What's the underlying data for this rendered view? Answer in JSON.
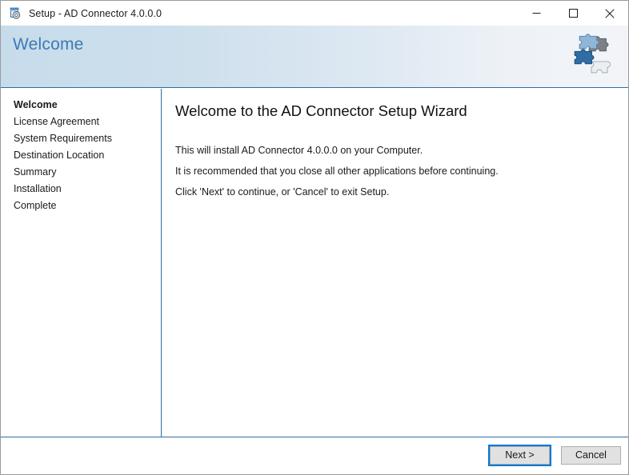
{
  "window": {
    "title": "Setup - AD Connector 4.0.0.0",
    "app_icon": "installer-box-icon",
    "controls": {
      "minimize": "minimize-icon",
      "maximize": "maximize-icon",
      "close": "close-icon"
    }
  },
  "header": {
    "title": "Welcome",
    "icon": "puzzle-pieces-icon",
    "accent_color": "#3d7ab5",
    "border_color": "#2e6da4",
    "gradient_from": "#c7dceb",
    "gradient_to": "#f2f4f8"
  },
  "sidebar": {
    "items": [
      {
        "label": "Welcome",
        "current": true
      },
      {
        "label": "License Agreement",
        "current": false
      },
      {
        "label": "System Requirements",
        "current": false
      },
      {
        "label": "Destination Location",
        "current": false
      },
      {
        "label": "Summary",
        "current": false
      },
      {
        "label": "Installation",
        "current": false
      },
      {
        "label": "Complete",
        "current": false
      }
    ]
  },
  "content": {
    "heading": "Welcome to the AD Connector Setup Wizard",
    "paragraphs": [
      "This will install AD Connector 4.0.0.0 on your Computer.",
      "It is recommended that you close all other applications before continuing.",
      "Click 'Next' to continue, or 'Cancel' to exit Setup."
    ]
  },
  "footer": {
    "next_label": "Next >",
    "cancel_label": "Cancel",
    "focus_color": "#0078d7"
  }
}
